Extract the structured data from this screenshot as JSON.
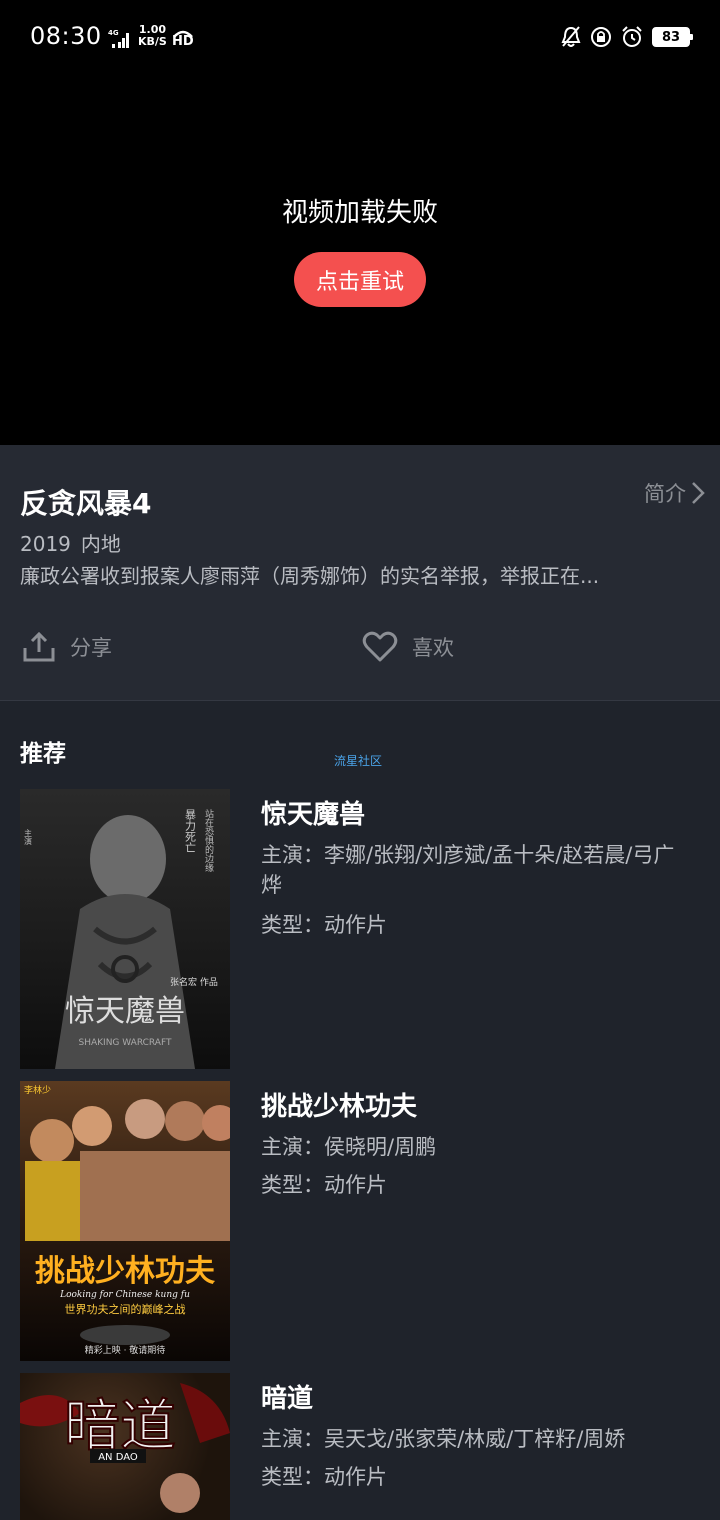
{
  "status_bar": {
    "time": "08:30",
    "network_type": "4G",
    "speed_value": "1.00",
    "speed_unit": "KB/S",
    "hd_label": "HD",
    "battery": "83",
    "icons": [
      "mute-bell-icon",
      "lock-rotation-icon",
      "alarm-icon",
      "battery-icon"
    ]
  },
  "player": {
    "error_message": "视频加载失败",
    "retry_label": "点击重试",
    "retry_color": "#f4504f"
  },
  "info": {
    "title": "反贪风暴4",
    "brief_label": "简介",
    "year": "2019",
    "region": "内地",
    "description": "廉政公署收到报案人廖雨萍（周秀娜饰）的实名举报，举报正在...",
    "share_label": "分享",
    "like_label": "喜欢"
  },
  "recommend": {
    "header": "推荐",
    "watermark": "流星社区",
    "items": [
      {
        "title": "惊天魔兽",
        "cast_label": "主演：",
        "cast": "李娜/张翔/刘彦斌/孟十朵/赵若晨/弓广烨",
        "genre_label": "类型：",
        "genre": "动作片",
        "poster_title": "惊天魔兽",
        "poster_subtitle": "SHAKING WARCRAFT",
        "poster_tagline": "暴力死亡",
        "poster_tagline2": "站在恐惧的边缘",
        "poster_director": "张名宏 作品"
      },
      {
        "title": "挑战少林功夫",
        "cast_label": "主演：",
        "cast": "侯晓明/周鹏",
        "genre_label": "类型：",
        "genre": "动作片",
        "poster_title": "挑战少林功夫",
        "poster_subtitle": "Looking for Chinese kung fu",
        "poster_tagline": "世界功夫之间的巅峰之战",
        "poster_footer": "精彩上映 · 敬请期待",
        "poster_corner": "李林少"
      },
      {
        "title": "暗道",
        "cast_label": "主演：",
        "cast": "吴天戈/张家荣/林威/丁梓籽/周娇",
        "genre_label": "类型：",
        "genre": "动作片",
        "poster_title": "暗道",
        "poster_subtitle": "AN DAO"
      }
    ]
  }
}
